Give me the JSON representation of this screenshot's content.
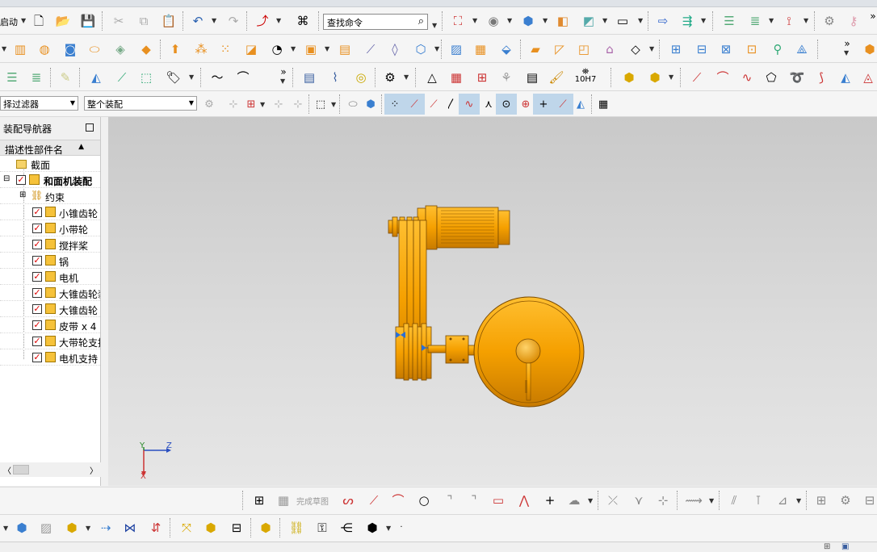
{
  "toolbar": {
    "start_label": "启动",
    "search_placeholder": "查找命令",
    "row1_icons": [
      "new-file-icon",
      "open-folder-icon",
      "save-icon",
      "cut-icon",
      "copy-icon",
      "paste-icon",
      "undo-icon",
      "redo-icon",
      "wcs-icon",
      "command-finder-icon",
      "fit-view-icon",
      "render-style-icon",
      "shaded-cube-icon",
      "section-view-icon",
      "view-orient-icon",
      "background-icon",
      "move-component-icon",
      "assembly-constraint-icon",
      "layer-icon",
      "layer-settings-icon",
      "csys-icon",
      "fastener-icon",
      "assembly-sequence-icon"
    ],
    "row2_icons": [
      "extrude-icon",
      "revolve-icon",
      "hole-icon",
      "boss-icon",
      "pocket-icon",
      "pad-icon",
      "emboss-icon",
      "pattern-feature-icon",
      "unite-icon",
      "subtract-icon",
      "blend-icon",
      "chamfer-icon",
      "sweep-icon",
      "thicken-icon",
      "shell-icon",
      "trim-body-icon",
      "split-body-icon",
      "offset-face-icon",
      "draft-icon",
      "pattern-face-icon",
      "replace-face-icon",
      "ruled-surface-icon",
      "through-curves-icon",
      "studio-surface-icon",
      "sew-icon",
      "patch-icon",
      "extension-icon",
      "bounding-body-icon"
    ],
    "row3_icons": [
      "layer-move-icon",
      "layer-copy-icon",
      "measure-icon",
      "datum-plane-icon",
      "datum-axis-icon",
      "datum-csys-icon",
      "annotation-icon",
      "line-curve-icon",
      "arc-icon",
      "thread-icon",
      "spring-icon",
      "washer-icon",
      "bolt-icon",
      "triangle-icon",
      "table-icon",
      "grid-icon",
      "pmi-icon",
      "note-icon",
      "brush-icon",
      "tolerance-icon",
      "wave-icon",
      "wave-link-icon",
      "line-icon",
      "arc-curve-icon",
      "spline-icon",
      "polygon-icon",
      "helix-icon",
      "offset-curve-icon",
      "bridge-curve-icon",
      "project-curve-icon"
    ],
    "tolerance_label": "10H7",
    "filter_type": "择过滤器",
    "filter_scope": "整个装配",
    "snap_icons": [
      "select-face-icon",
      "select-body-icon",
      "snap-endpoint-icon",
      "snap-midpoint-icon",
      "snap-control-icon",
      "snap-intersection-icon",
      "snap-arc-center-icon",
      "snap-quadrant-icon",
      "snap-point-on-curve-icon",
      "snap-existing-point-icon",
      "snap-bounded-icon",
      "snap-grid-icon",
      "snap-face-icon"
    ]
  },
  "navigator": {
    "title": "装配导航器",
    "column_header": "描述性部件名",
    "section_item": "截面",
    "root": "和面机装配",
    "constraints": "约束",
    "components": [
      "小锥齿轮",
      "小带轮",
      "搅拌桨",
      "锅",
      "电机",
      "大锥齿轮装",
      "大锥齿轮",
      "皮带 x 4",
      "大带轮支持",
      "电机支持"
    ]
  },
  "viewport": {
    "axis_y": "Y",
    "axis_z": "Z",
    "axis_x": "X",
    "model_color": "#FFA500"
  },
  "sketch_bar": {
    "finish_label": "完成草图",
    "icons": [
      "sketch-icon",
      "finish-sketch-icon",
      "profile-icon",
      "line-tool-icon",
      "arc-tool-icon",
      "circle-tool-icon",
      "fillet-tool-icon",
      "chamfer-tool-icon",
      "rectangle-tool-icon",
      "polygon-tool-icon",
      "point-tool-icon",
      "studio-spline-icon",
      "quick-trim-icon",
      "quick-extend-icon",
      "make-corner-icon",
      "offset-icon",
      "mirror-icon",
      "constraint-icon",
      "dimension-icon",
      "geometric-constraint-icon",
      "display-constraints-icon"
    ]
  },
  "assembly_bar": {
    "icons": [
      "component-icon",
      "add-component-icon",
      "new-component-icon",
      "mirror-assembly-icon",
      "constraints-assembly-icon",
      "move-assembly-icon",
      "explode-icon",
      "sequence-icon",
      "wave-geometry-icon",
      "link-icon",
      "check-clearance-icon",
      "arrangement-icon",
      "bom-icon",
      "reuse-library-icon"
    ]
  },
  "status_icons": [
    "display-icon",
    "window-icon"
  ]
}
